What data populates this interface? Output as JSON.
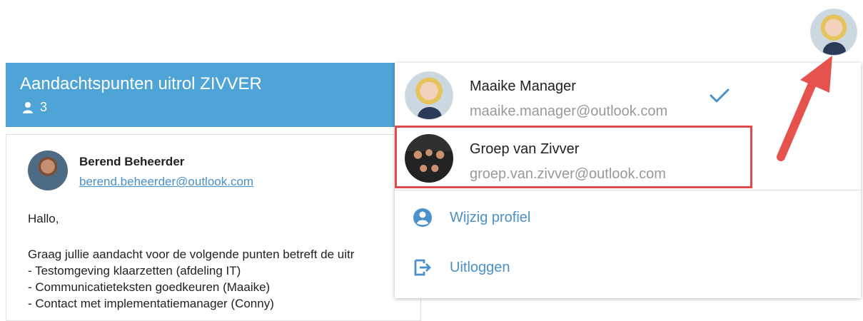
{
  "conversation": {
    "title": "Aandachtspunten uitrol ZIVVER",
    "participant_count": "3"
  },
  "message": {
    "sender_name": "Berend Beheerder",
    "sender_email": "berend.beheerder@outlook.com",
    "greeting": "Hallo,",
    "lines": [
      "Graag jullie aandacht voor de volgende punten betreft de uitr",
      "- Testomgeving klaarzetten (afdeling IT)",
      "- Communicatieteksten goedkeuren (Maaike)",
      "- Contact met implementatiemanager (Conny)"
    ]
  },
  "account_menu": {
    "accounts": [
      {
        "name": "Maaike Manager",
        "email": "maaike.manager@outlook.com",
        "selected": true
      },
      {
        "name": "Groep van Zivver",
        "email": "groep.van.zivver@outlook.com",
        "selected": false
      }
    ],
    "actions": [
      {
        "label": "Wijzig profiel",
        "icon": "profile-icon"
      },
      {
        "label": "Uitloggen",
        "icon": "logout-icon"
      }
    ]
  },
  "colors": {
    "header_blue": "#4ea3d7",
    "link_blue": "#4a90c9",
    "highlight_red": "#df4b4b",
    "arrow_red": "#e6534f"
  }
}
